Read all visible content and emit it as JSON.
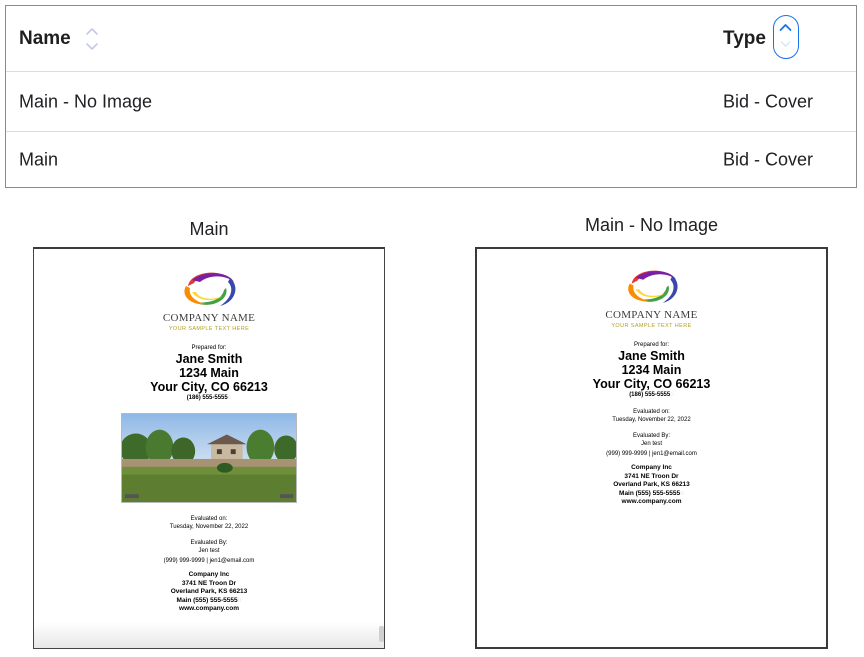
{
  "table": {
    "columns": {
      "name": {
        "label": "Name",
        "sort_icon": "sort-unsorted-icon"
      },
      "type": {
        "label": "Type",
        "sort_icon": "sort-ascending-icon"
      }
    },
    "rows": [
      {
        "name": "Main - No Image",
        "type": "Bid - Cover"
      },
      {
        "name": "Main",
        "type": "Bid - Cover"
      }
    ]
  },
  "previews": [
    {
      "caption": "Main",
      "company_name": "COMPANY NAME",
      "tagline": "YOUR SAMPLE TEXT HERE",
      "prepared_for_label": "Prepared for:",
      "client_name": "Jane Smith",
      "address_line1": "1234 Main",
      "address_line2": "Your City, CO 66213",
      "client_phone": "(186) 555-5555",
      "has_photo": true,
      "evaluated_on_label": "Evaluated on:",
      "evaluated_on_date": "Tuesday, November 22, 2022",
      "evaluated_by_label": "Evaluated By:",
      "evaluator_name": "Jen test",
      "evaluator_contact": "(999) 999-9999 | jen1@email.com",
      "company": "Company Inc",
      "company_street": "3741 NE Troon Dr",
      "company_city": "Overland Park, KS 66213",
      "company_phone": "Main (555) 555-5555",
      "company_web": "www.company.com"
    },
    {
      "caption": "Main - No Image",
      "company_name": "COMPANY NAME",
      "tagline": "YOUR SAMPLE TEXT HERE",
      "prepared_for_label": "Prepared for:",
      "client_name": "Jane Smith",
      "address_line1": "1234 Main",
      "address_line2": "Your City, CO 66213",
      "client_phone": "(186) 555-5555",
      "has_photo": false,
      "evaluated_on_label": "Evaluated on:",
      "evaluated_on_date": "Tuesday, November 22, 2022",
      "evaluated_by_label": "Evaluated By:",
      "evaluator_name": "Jen test",
      "evaluator_contact": "(999) 999-9999 | jen1@email.com",
      "company": "Company Inc",
      "company_street": "3741 NE Troon Dr",
      "company_city": "Overland Park, KS 66213",
      "company_phone": "Main (555) 555-5555",
      "company_web": "www.company.com"
    }
  ],
  "colors": {
    "accent": "#1a73e8",
    "table_border": "#8a8a8a",
    "row_divider": "#dcdcdc",
    "tagline": "#b5a020"
  }
}
